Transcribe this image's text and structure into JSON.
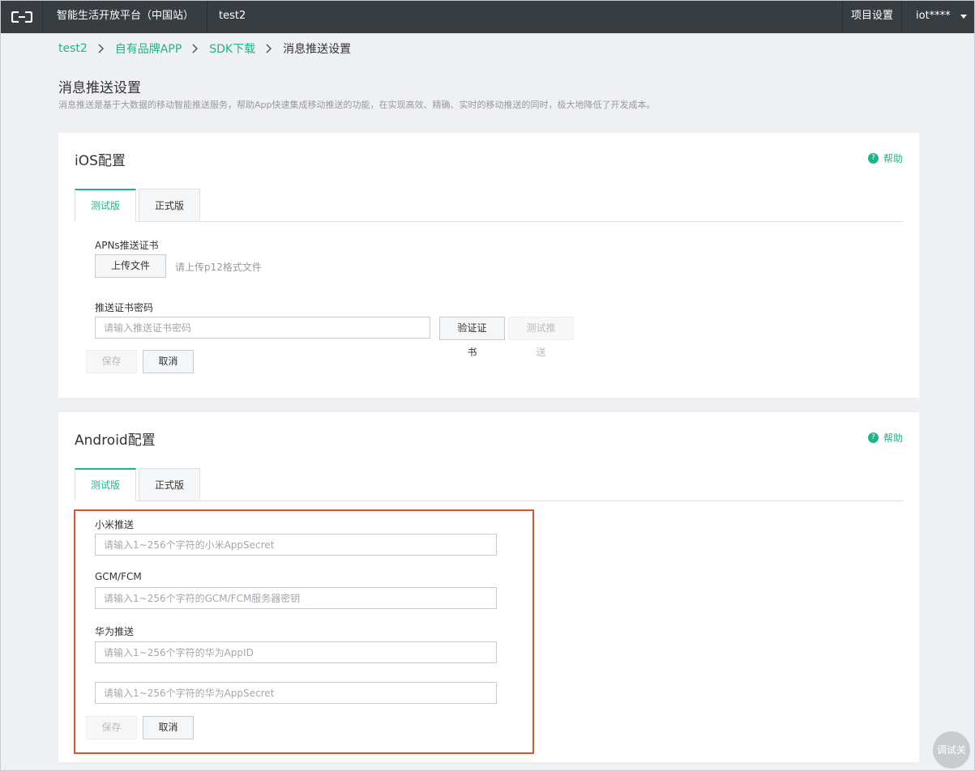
{
  "topbar": {
    "logo": "aliyun-logo-icon",
    "platform": "智能生活开放平台（中国站）",
    "project": "test2",
    "project_settings": "项目设置",
    "user": "iot****"
  },
  "breadcrumb": {
    "items": [
      "test2",
      "自有品牌APP",
      "SDK下载",
      "消息推送设置"
    ]
  },
  "page": {
    "title": "消息推送设置",
    "description": "消息推送是基于大数据的移动智能推送服务，帮助App快速集成移动推送的功能，在实现高效、精确、实时的移动推送的同时，极大地降低了开发成本。"
  },
  "ios": {
    "title": "iOS配置",
    "help": "帮助",
    "tabs": [
      "测试版",
      "正式版"
    ],
    "apns_label": "APNs推送证书",
    "upload_button": "上传文件",
    "upload_hint": "请上传p12格式文件",
    "password_label": "推送证书密码",
    "password_placeholder": "请输入推送证书密码",
    "verify_button_line1": "验证证",
    "verify_button_line2": "书",
    "test_push_line1": "测试推",
    "test_push_line2": "送",
    "save_button": "保存",
    "cancel_button": "取消"
  },
  "android": {
    "title": "Android配置",
    "help": "帮助",
    "tabs": [
      "测试版",
      "正式版"
    ],
    "xiaomi_label": "小米推送",
    "xiaomi_placeholder": "请输入1~256个字符的小米AppSecret",
    "gcm_label": "GCM/FCM",
    "gcm_placeholder": "请输入1~256个字符的GCM/FCM服务器密钥",
    "huawei_label": "华为推送",
    "huawei_appid_placeholder": "请输入1~256个字符的华为AppID",
    "huawei_secret_placeholder": "请输入1~256个字符的华为AppSecret",
    "save_button": "保存",
    "cancel_button": "取消"
  },
  "debug_button": "调试关",
  "colors": {
    "accent": "#1fb38a",
    "topbar": "#373d41",
    "highlight": "#e0522f"
  }
}
